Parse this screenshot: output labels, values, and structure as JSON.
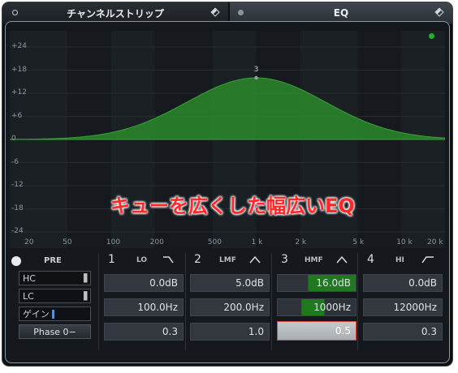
{
  "tabs": {
    "left_label": "チャンネルストリップ",
    "right_label": "EQ"
  },
  "graph": {
    "y_ticks": [
      "+24",
      "+18",
      "+12",
      "+6",
      "0",
      "-6",
      "-12",
      "-18",
      "-24"
    ],
    "x_ticks": [
      "20",
      "50",
      "100",
      "200",
      "500",
      "1 k",
      "2 k",
      "5 k",
      "10 k",
      "20 k"
    ],
    "band_marker_label": "3",
    "overlay_caption": "キューを広くした幅広いEQ"
  },
  "eq_curve": {
    "peak_frequency_hz": 1000,
    "peak_gain_db": 16.0,
    "q": 0.5
  },
  "left_controls": {
    "pre_label": "PRE",
    "hc_label": "HC",
    "lc_label": "LC",
    "gain_label": "ゲイン",
    "phase_label": "Phase 0",
    "phase_suffix": "−"
  },
  "bands": [
    {
      "number": "1",
      "name": "LO",
      "gain": "0.0dB",
      "freq": "100.0Hz",
      "q": "0.3",
      "icon": "low-shelf-icon"
    },
    {
      "number": "2",
      "name": "LMF",
      "gain": "5.0dB",
      "freq": "200.0Hz",
      "q": "1.0",
      "icon": "peak-icon"
    },
    {
      "number": "3",
      "name": "HMF",
      "gain": "16.0dB",
      "freq": "1000Hz",
      "q": "0.5",
      "icon": "peak-icon"
    },
    {
      "number": "4",
      "name": "HI",
      "gain": "0.0dB",
      "freq": "12000Hz",
      "q": "0.3",
      "icon": "high-shelf-icon"
    }
  ],
  "colors": {
    "curve_fill": "#2b8a2b",
    "caption": "#ff2828",
    "indicator": "#22b229"
  }
}
